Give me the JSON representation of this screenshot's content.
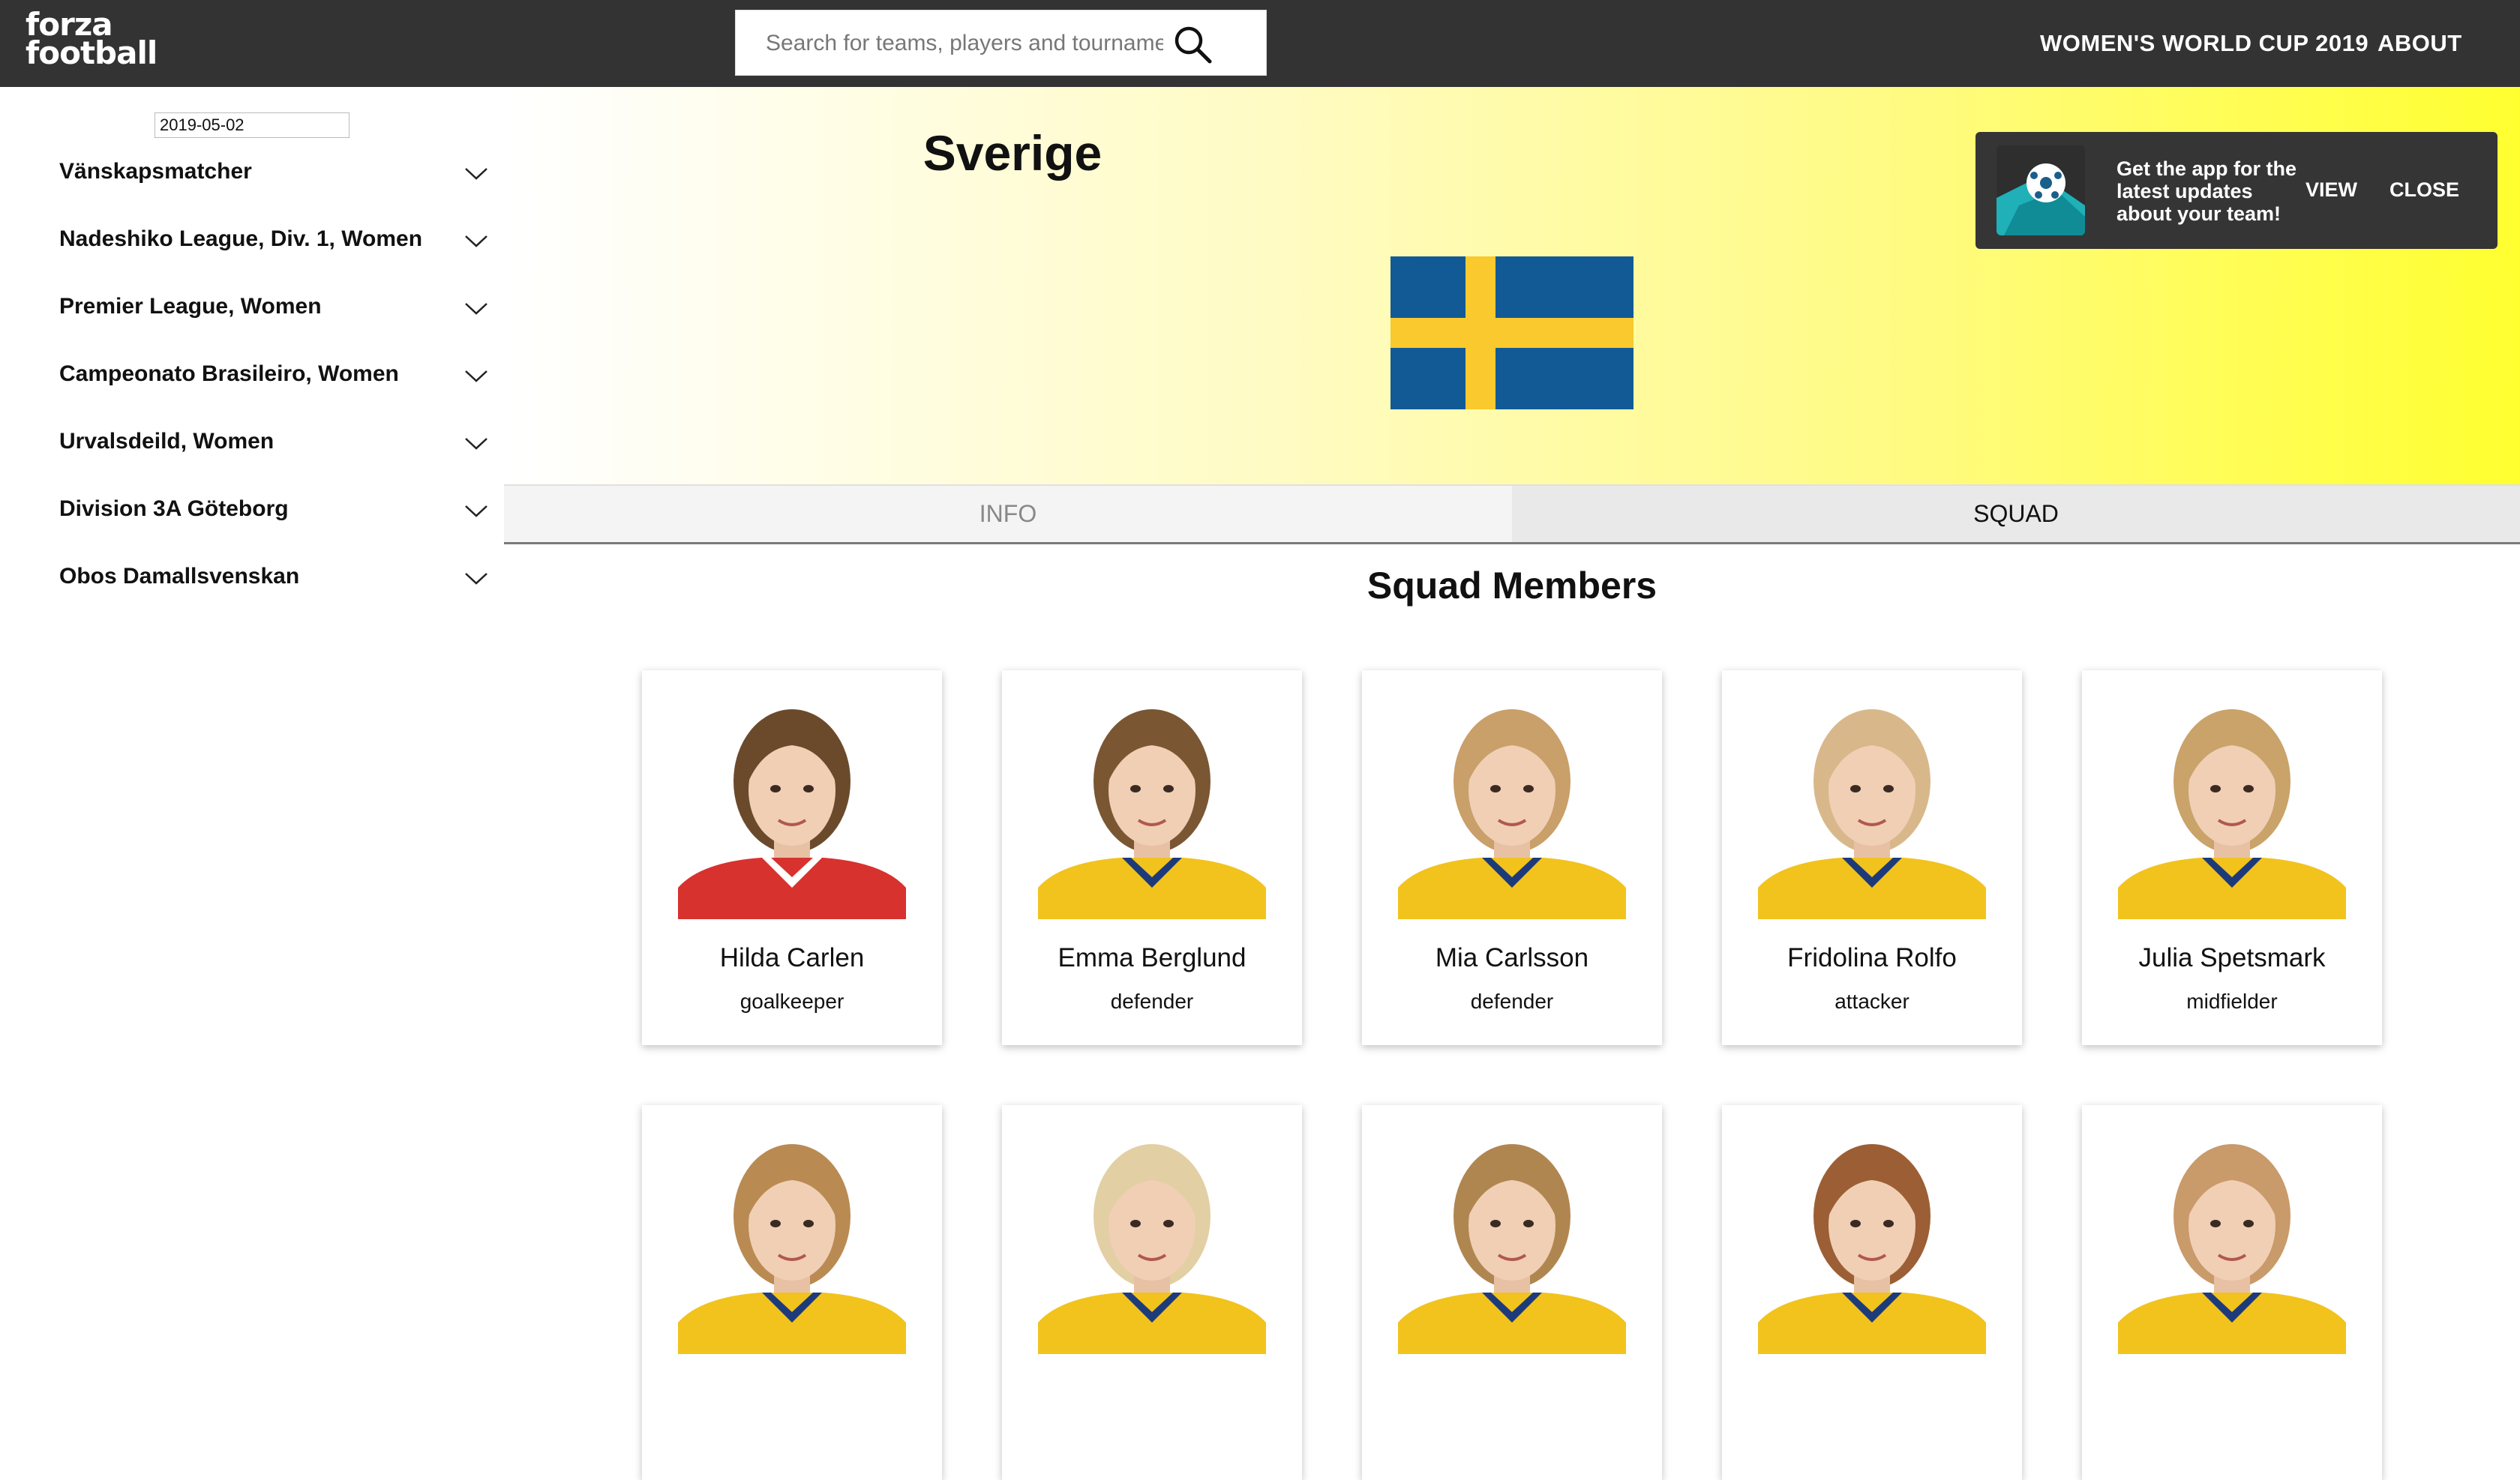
{
  "header": {
    "logo_text_line1": "forza",
    "logo_text_line2": "football",
    "search_placeholder": "Search for teams, players and tournaments",
    "nav": [
      "WOMEN'S WORLD CUP 2019",
      "ABOUT"
    ]
  },
  "sidebar": {
    "date": "2019-05-02",
    "leagues": [
      "Vänskapsmatcher",
      "Nadeshiko League, Div. 1, Women",
      "Premier League, Women",
      "Campeonato Brasileiro, Women",
      "Urvalsdeild, Women",
      "Division 3A Göteborg",
      "Obos Damallsvenskan"
    ]
  },
  "team": {
    "name": "Sverige",
    "flag_colors": {
      "blue": "#125a96",
      "yellow": "#f9c92d"
    }
  },
  "promo": {
    "text": "Get the app for the latest updates about your team!",
    "view_label": "VIEW",
    "close_label": "CLOSE"
  },
  "tabs": {
    "info": "INFO",
    "squad": "SQUAD"
  },
  "squad": {
    "title": "Squad Members",
    "players": [
      {
        "name": "Hilda Carlen",
        "position": "goalkeeper",
        "hair": "#6b4a2c",
        "shirt": "#d8322e",
        "collar": "#ffffff"
      },
      {
        "name": "Emma Berglund",
        "position": "defender",
        "hair": "#7a5632",
        "shirt": "#f1c31c",
        "collar": "#1d3b7a"
      },
      {
        "name": "Mia Carlsson",
        "position": "defender",
        "hair": "#c99f6a",
        "shirt": "#f1c31c",
        "collar": "#1d3b7a"
      },
      {
        "name": "Fridolina Rolfo",
        "position": "attacker",
        "hair": "#d8b88a",
        "shirt": "#f1c31c",
        "collar": "#1d3b7a"
      },
      {
        "name": "Julia Spetsmark",
        "position": "midfielder",
        "hair": "#c9a36a",
        "shirt": "#f1c31c",
        "collar": "#1d3b7a"
      },
      {
        "name": "",
        "position": "",
        "hair": "#b98b52",
        "shirt": "#f1c31c",
        "collar": "#1d3b7a"
      },
      {
        "name": "",
        "position": "",
        "hair": "#e2cfa3",
        "shirt": "#f1c31c",
        "collar": "#1d3b7a"
      },
      {
        "name": "",
        "position": "",
        "hair": "#b08650",
        "shirt": "#f1c31c",
        "collar": "#1d3b7a"
      },
      {
        "name": "",
        "position": "",
        "hair": "#9c5e34",
        "shirt": "#f1c31c",
        "collar": "#1d3b7a"
      },
      {
        "name": "",
        "position": "",
        "hair": "#c99a6a",
        "shirt": "#f1c31c",
        "collar": "#1d3b7a"
      }
    ]
  }
}
